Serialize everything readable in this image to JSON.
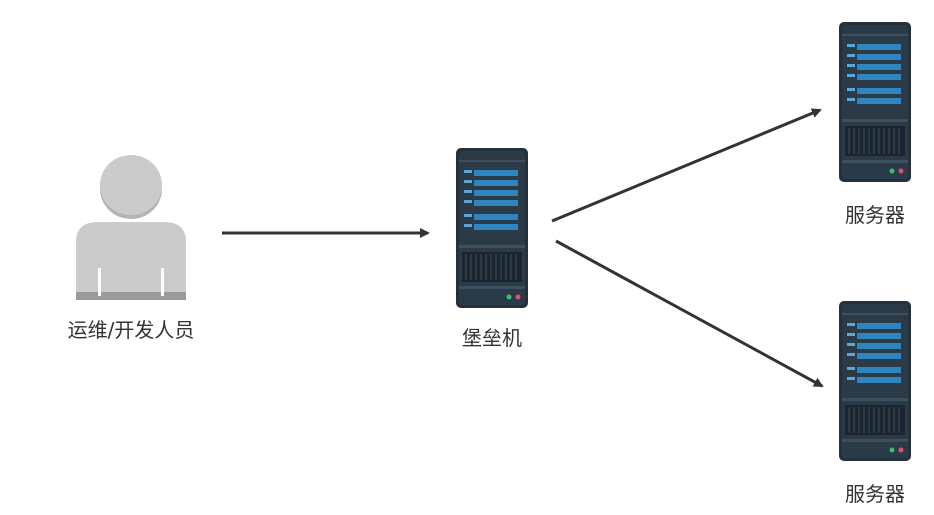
{
  "nodes": {
    "user": {
      "label": "运维/开发人员",
      "icon": "person-icon"
    },
    "bastion": {
      "label": "堡垒机",
      "icon": "server-icon"
    },
    "server_1": {
      "label": "服务器",
      "icon": "server-icon"
    },
    "server_2": {
      "label": "服务器",
      "icon": "server-icon"
    }
  },
  "edges": [
    {
      "from": "user",
      "to": "bastion"
    },
    {
      "from": "bastion",
      "to": "server_1"
    },
    {
      "from": "bastion",
      "to": "server_2"
    }
  ],
  "colors": {
    "server_body": "#2b3a47",
    "server_bar": "#2f86bf",
    "server_bar_light": "#5aa6d6",
    "led_green": "#3bbf6a",
    "led_red": "#e0506b",
    "person": "#c8c8c8",
    "person_shade": "#9a9a9a",
    "arrow": "#333333"
  }
}
